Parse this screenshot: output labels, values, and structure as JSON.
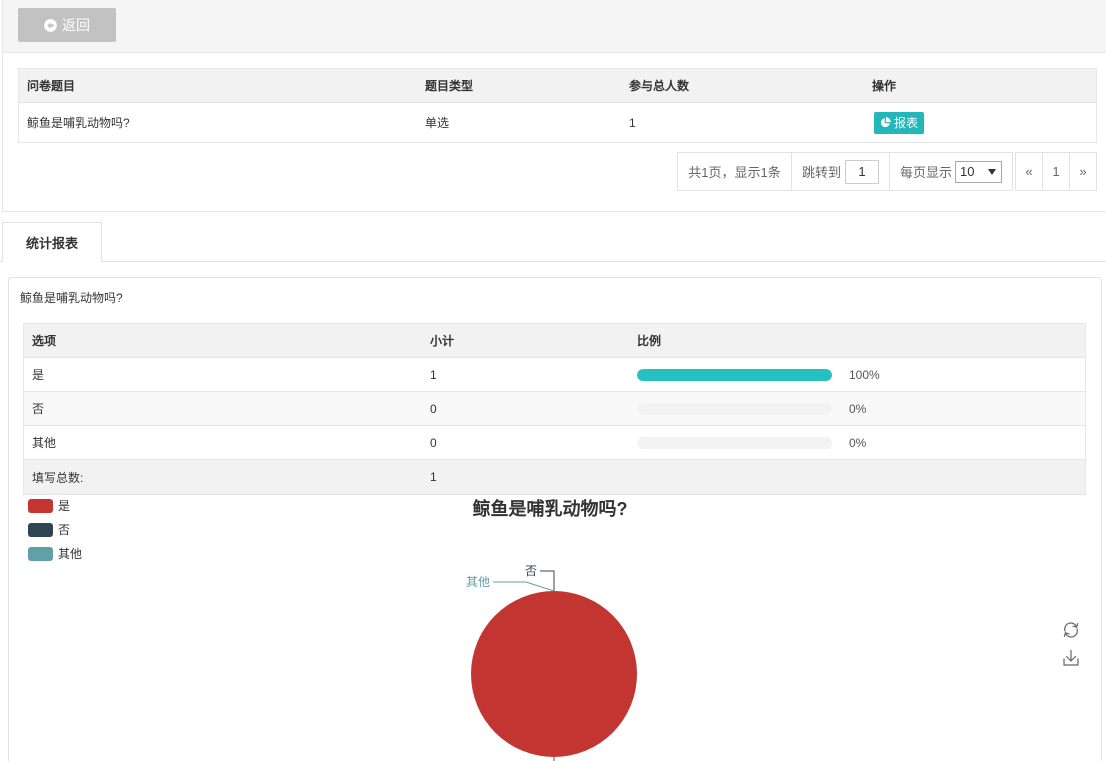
{
  "header": {
    "back_label": "返回"
  },
  "questions_table": {
    "columns": [
      "问卷题目",
      "题目类型",
      "参与总人数",
      "操作"
    ],
    "rows": [
      {
        "title": "鲸鱼是哺乳动物吗?",
        "type": "单选",
        "participants": "1",
        "action_label": "报表"
      }
    ]
  },
  "pagination": {
    "summary": "共1页，显示1条",
    "jump_label": "跳转到",
    "jump_value": "1",
    "per_page_label": "每页显示",
    "per_page_value": "10",
    "prev": "«",
    "current_page": "1",
    "next": "»"
  },
  "tabs": [
    {
      "label": "统计报表",
      "active": true
    }
  ],
  "stats": {
    "question": "鲸鱼是哺乳动物吗?",
    "columns": [
      "选项",
      "小计",
      "比例"
    ],
    "rows": [
      {
        "option": "是",
        "count": "1",
        "ratio": 1,
        "ratio_label": "100%"
      },
      {
        "option": "否",
        "count": "0",
        "ratio": 0,
        "ratio_label": "0%"
      },
      {
        "option": "其他",
        "count": "0",
        "ratio": 0,
        "ratio_label": "0%"
      }
    ],
    "total_label": "填写总数:",
    "total_value": "1"
  },
  "colors": {
    "accent": "#23b7b7",
    "progress": "#25c0c2",
    "back_button": "#c2c2c2"
  },
  "icons": {
    "back": "circle-arrow-left-icon",
    "report": "pie-chart-icon",
    "page_size_caret": "caret-down-icon",
    "restore": "refresh-icon",
    "save_image": "download-icon"
  },
  "chart_data": {
    "type": "pie",
    "title": "鲸鱼是哺乳动物吗?",
    "categories": [
      "是",
      "否",
      "其他"
    ],
    "values": [
      1,
      0,
      0
    ],
    "colors": [
      "#c23531",
      "#2f4554",
      "#61a0a8"
    ],
    "legend": "top-left"
  }
}
